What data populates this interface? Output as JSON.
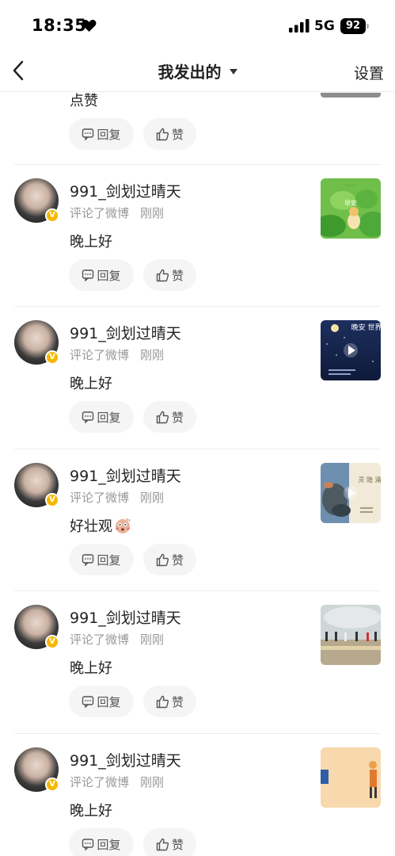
{
  "status_bar": {
    "time": "18:35",
    "network": "5G",
    "battery": "92"
  },
  "nav": {
    "title": "我发出的",
    "settings": "设置"
  },
  "partial": {
    "text": "点赞",
    "reply_label": "回复",
    "like_label": "赞"
  },
  "items": [
    {
      "username": "991_剑划过晴天",
      "action": "评论了微博",
      "time": "刚刚",
      "comment": "晚上好",
      "thumb_label": "早安",
      "reply_label": "回复",
      "like_label": "赞"
    },
    {
      "username": "991_剑划过晴天",
      "action": "评论了微博",
      "time": "刚刚",
      "comment": "晚上好",
      "thumb_label": "晚安 世界",
      "reply_label": "回复",
      "like_label": "赞"
    },
    {
      "username": "991_剑划过晴天",
      "action": "评论了微博",
      "time": "刚刚",
      "comment": "好壮观",
      "thumb_label": "灵 隐 涌",
      "reply_label": "回复",
      "like_label": "赞"
    },
    {
      "username": "991_剑划过晴天",
      "action": "评论了微博",
      "time": "刚刚",
      "comment": "晚上好",
      "thumb_label": "",
      "reply_label": "回复",
      "like_label": "赞"
    },
    {
      "username": "991_剑划过晴天",
      "action": "评论了微博",
      "time": "刚刚",
      "comment": "晚上好",
      "thumb_label": "",
      "reply_label": "回复",
      "like_label": "赞"
    }
  ],
  "colors": {
    "verified": "#f5b800",
    "button_bg": "#f5f5f5",
    "meta_text": "#999999"
  },
  "icons": [
    "heart-icon",
    "signal-icon",
    "back-icon",
    "caret-down-icon",
    "verified-icon",
    "comment-icon",
    "thumbs-up-icon",
    "play-icon",
    "shocked-emoji-icon"
  ]
}
